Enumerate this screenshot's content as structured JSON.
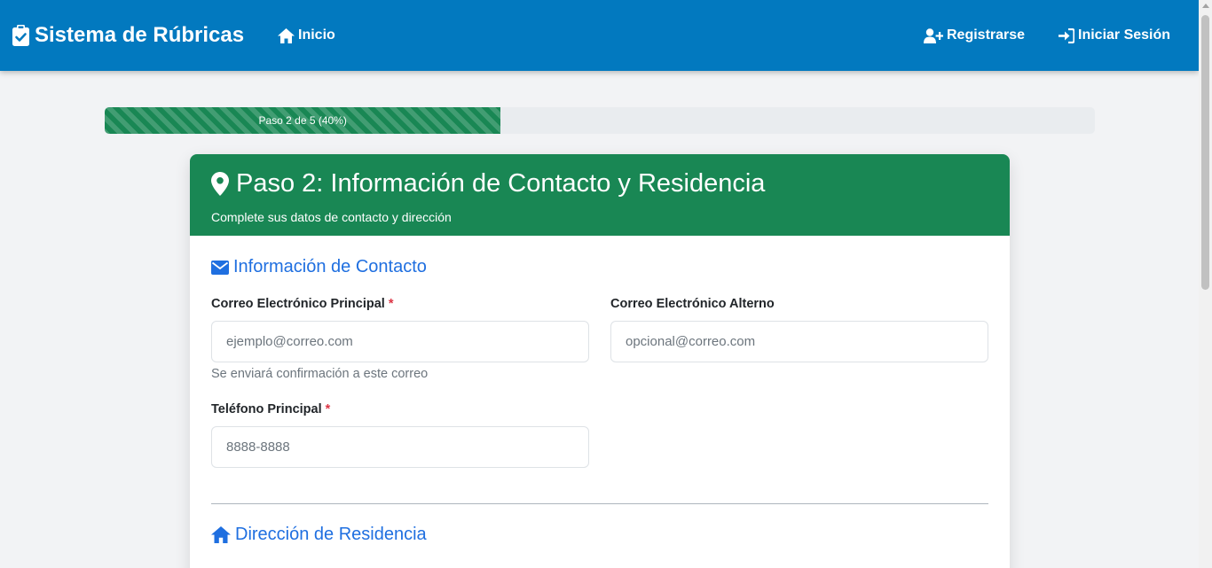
{
  "navbar": {
    "brand": "Sistema de Rúbricas",
    "inicio": "Inicio",
    "registrarse": "Registrarse",
    "iniciar_sesion": "Iniciar Sesión",
    "color": "#0279bf"
  },
  "progress": {
    "label": "Paso 2 de 5 (40%)",
    "value_percent": 40,
    "color": "#198754"
  },
  "card": {
    "title": "Paso 2: Información de Contacto y Residencia",
    "subtitle": "Complete sus datos de contacto y dirección"
  },
  "contacto": {
    "title": "Información de Contacto",
    "email_label": "Correo Electrónico Principal",
    "email_placeholder": "ejemplo@correo.com",
    "email_help": "Se enviará confirmación a este correo",
    "email_alt_label": "Correo Electrónico Alterno",
    "email_alt_placeholder": "opcional@correo.com",
    "phone_label": "Teléfono Principal",
    "phone_placeholder": "8888-8888",
    "required_mark": "*"
  },
  "residencia": {
    "title": "Dirección de Residencia"
  }
}
